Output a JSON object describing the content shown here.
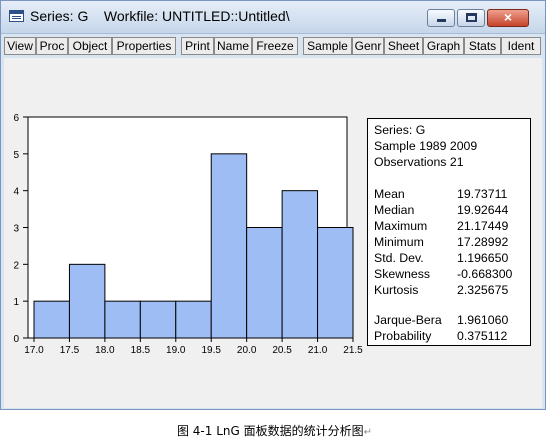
{
  "window": {
    "title": "Series: G    Workfile: UNTITLED::Untitled\\",
    "close_label": "×"
  },
  "toolbar": {
    "buttons": [
      "View",
      "Proc",
      "Object",
      "Properties",
      "Print",
      "Name",
      "Freeze",
      "Sample",
      "Genr",
      "Sheet",
      "Graph",
      "Stats",
      "Ident"
    ]
  },
  "chart_data": {
    "type": "bar",
    "title": "",
    "xlabel": "",
    "ylabel": "",
    "bins": [
      {
        "from": 17.0,
        "to": 17.5,
        "count": 1
      },
      {
        "from": 17.5,
        "to": 18.0,
        "count": 2
      },
      {
        "from": 18.0,
        "to": 18.5,
        "count": 1
      },
      {
        "from": 18.5,
        "to": 19.0,
        "count": 1
      },
      {
        "from": 19.0,
        "to": 19.5,
        "count": 1
      },
      {
        "from": 19.5,
        "to": 20.0,
        "count": 5
      },
      {
        "from": 20.0,
        "to": 20.5,
        "count": 3
      },
      {
        "from": 20.5,
        "to": 21.0,
        "count": 4
      },
      {
        "from": 21.0,
        "to": 21.5,
        "count": 3
      }
    ],
    "x_ticks": [
      "17.0",
      "17.5",
      "18.0",
      "18.5",
      "19.0",
      "19.5",
      "20.0",
      "20.5",
      "21.0",
      "21.5"
    ],
    "y_ticks": [
      "0",
      "1",
      "2",
      "3",
      "4",
      "5",
      "6"
    ],
    "xlim": [
      17.0,
      21.5
    ],
    "ylim": [
      0,
      6
    ],
    "grid": false,
    "bar_color": "#9ebdf5"
  },
  "stats": {
    "series": "Series: G",
    "sample": "Sample 1989 2009",
    "observations": "Observations 21",
    "rows": [
      {
        "label": "Mean",
        "value": "19.73711"
      },
      {
        "label": "Median",
        "value": "19.92644"
      },
      {
        "label": "Maximum",
        "value": "21.17449"
      },
      {
        "label": "Minimum",
        "value": "17.28992"
      },
      {
        "label": "Std. Dev.",
        "value": "1.196650"
      },
      {
        "label": "Skewness",
        "value": "-0.668300"
      },
      {
        "label": "Kurtosis",
        "value": "2.325675"
      }
    ],
    "jb_label": "Jarque-Bera",
    "jb_value": "1.961060",
    "prob_label": "Probability",
    "prob_value": "0.375112"
  },
  "caption": {
    "text": "图 4-1 LnG 面板数据的统计分析图",
    "mark": "↵"
  }
}
